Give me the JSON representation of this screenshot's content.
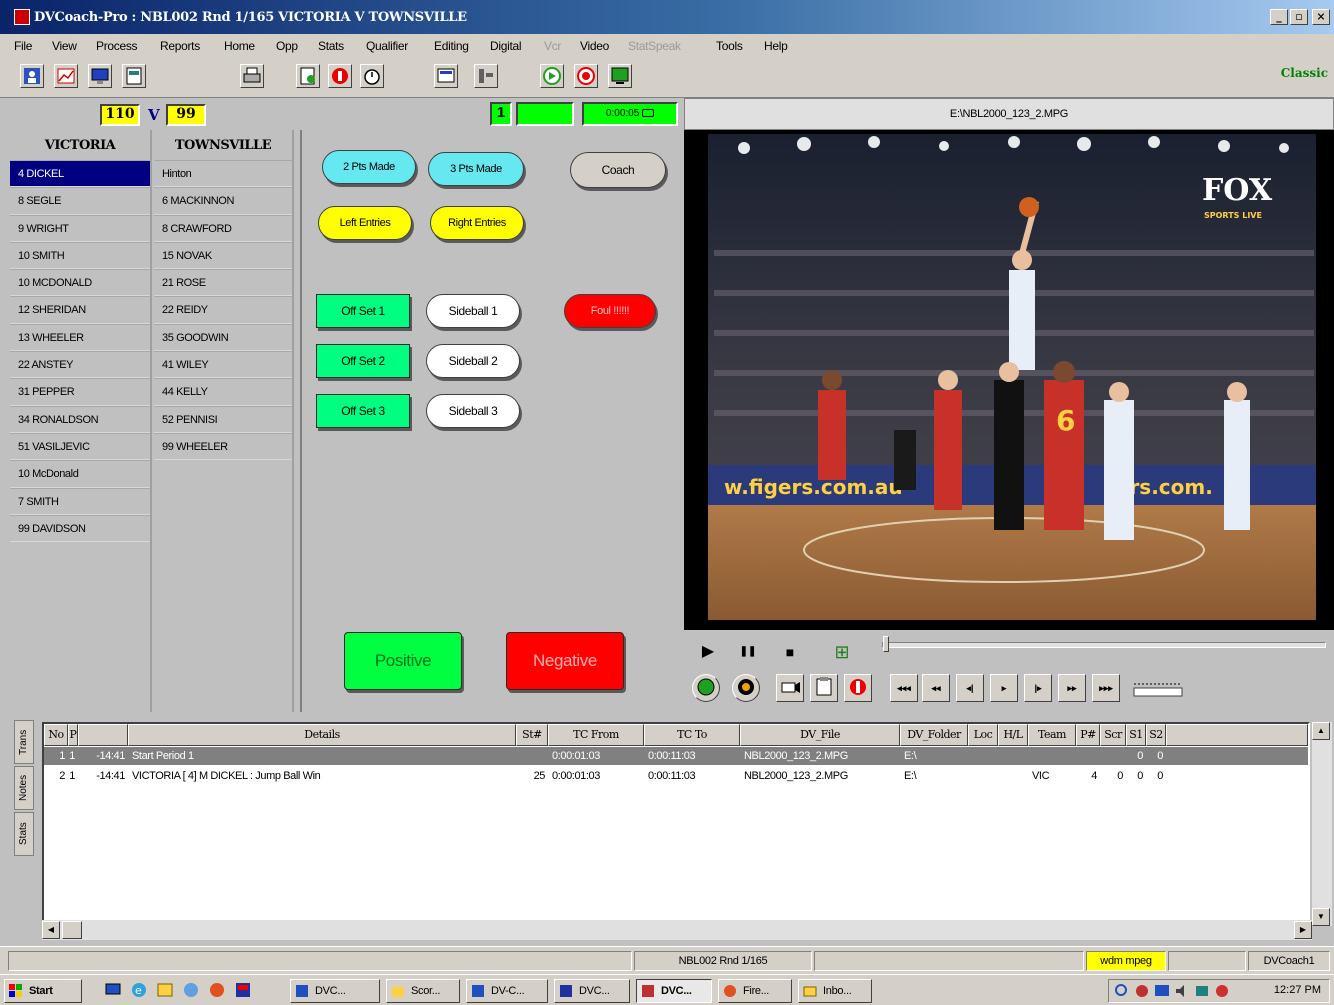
{
  "window": {
    "title": "DVCoach-Pro : NBL002 Rnd 1/165 VICTORIA V TOWNSVILLE",
    "controls": [
      "_",
      "▫",
      "×"
    ]
  },
  "menu": [
    "File",
    "View",
    "Process",
    "Reports",
    "Home",
    "Opp",
    "Stats",
    "Qualifier",
    "Editing",
    "Digital",
    "Vcr",
    "Video",
    "StatSpeak",
    "Tools",
    "Help"
  ],
  "menu_disabled": [
    "Vcr",
    "StatSpeak"
  ],
  "toolbar": {
    "mode_label": "Classic"
  },
  "score": {
    "home": "110",
    "versus": "V",
    "away": "99",
    "period": "1",
    "timer": "0:00:05"
  },
  "file_bar": {
    "path": "E:\\NBL2000_123_2.MPG"
  },
  "rosters": {
    "home": {
      "team": "VICTORIA",
      "players": [
        "4   DICKEL",
        "8   SEGLE",
        "9   WRIGHT",
        "10  SMITH",
        "10  MCDONALD",
        "12  SHERIDAN",
        "13  WHEELER",
        "22  ANSTEY",
        "31  PEPPER",
        "34  RONALDSON",
        "51  VASILJEVIC",
        "10  McDonald",
        "7    SMITH",
        "99  DAVIDSON"
      ],
      "selected_index": 0
    },
    "away": {
      "team": "TOWNSVILLE",
      "players": [
        "Hinton",
        "6   MACKINNON",
        "8   CRAWFORD",
        "15  NOVAK",
        "21  ROSE",
        "22  REIDY",
        "35  GOODWIN",
        "41  WILEY",
        "44  KELLY",
        "52  PENNISI",
        "99  WHEELER"
      ]
    }
  },
  "actions": {
    "pts2": "2 Pts Made",
    "pts3": "3 Pts Made",
    "coach": "Coach",
    "left_entries": "Left Entries",
    "right_entries": "Right Entries",
    "off_set_1": "Off Set 1",
    "off_set_2": "Off Set 2",
    "off_set_3": "Off Set 3",
    "sideball_1": "Sideball 1",
    "sideball_2": "Sideball 2",
    "sideball_3": "Sideball 3",
    "foul": "Foul !!!!!!",
    "positive": "Positive",
    "negative": "Negative"
  },
  "video": {
    "channel_logo": "FOX",
    "channel_sub": "SPORTS LIVE",
    "ad_left": "w.figers.com.au",
    "ad_right": "w   rs.com."
  },
  "playback": {
    "play": "▶",
    "pause": "❚❚",
    "stop": "■",
    "grid": "⊞",
    "scrub_position": 0.0
  },
  "side_tabs": [
    "Trans",
    "Notes",
    "Stats"
  ],
  "log": {
    "columns": [
      "No",
      "P",
      "",
      "Details",
      "St#",
      "TC From",
      "TC To",
      "DV_File",
      "DV_Folder",
      "Loc",
      "H/L",
      "Team",
      "P#",
      "Scr",
      "S1",
      "S2"
    ],
    "rows": [
      {
        "no": "1",
        "p": "1",
        "time": "-14:41",
        "details": "Start Period 1",
        "st": "",
        "tc_from": "0:00:01:03",
        "tc_to": "0:00:11:03",
        "dv_file": "NBL2000_123_2.MPG",
        "dv_folder": "E:\\",
        "loc": "",
        "hl": "",
        "team": "",
        "pnum": "",
        "scr": "",
        "s1": "0",
        "s2": "0",
        "selected": true
      },
      {
        "no": "2",
        "p": "1",
        "time": "-14:41",
        "details": "VICTORIA [  4] M DICKEL :  Jump Ball Win",
        "st": "25",
        "tc_from": "0:00:01:03",
        "tc_to": "0:00:11:03",
        "dv_file": "NBL2000_123_2.MPG",
        "dv_folder": "E:\\",
        "loc": "",
        "hl": "",
        "team": "VIC",
        "pnum": "4",
        "scr": "0",
        "s1": "0",
        "s2": "0",
        "selected": false
      }
    ]
  },
  "status": {
    "game": "NBL002 Rnd 1/165",
    "codec": "wdm mpeg",
    "user": "DVCoach1"
  },
  "taskbar": {
    "start": "Start",
    "tasks": [
      "DVC...",
      "Scor...",
      "DV-C...",
      "DVC...",
      "DVC...",
      "Fire...",
      "Inbo..."
    ],
    "active_index": 4,
    "clock": "12:27 PM"
  },
  "colors": {
    "selected_row": "#000080",
    "score_yellow": "#ffff00",
    "green": "#00ff00",
    "red": "#ff0000",
    "cyan": "#66e8f0"
  }
}
